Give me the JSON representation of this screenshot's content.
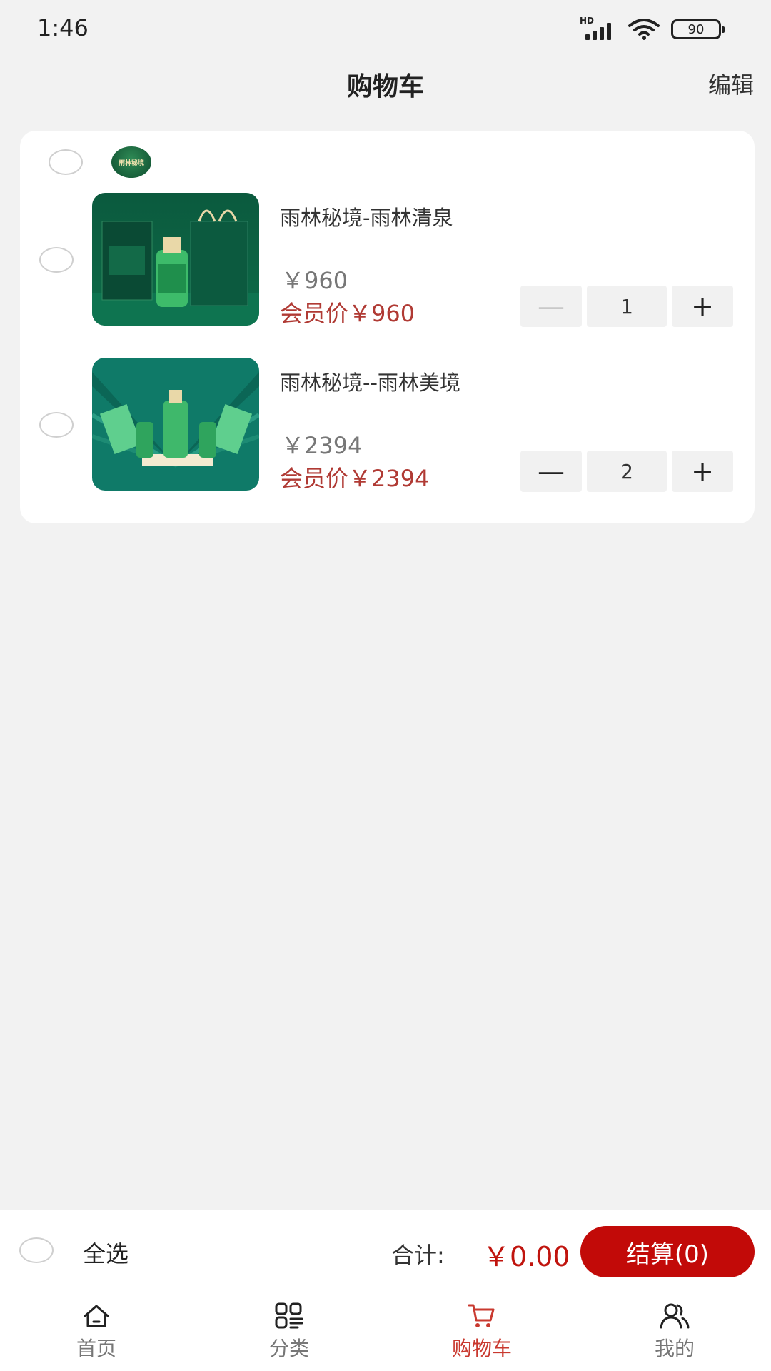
{
  "status_bar": {
    "time": "1:46",
    "network_label": "HD",
    "battery": "90"
  },
  "header": {
    "title": "购物车",
    "edit_label": "编辑"
  },
  "store": {
    "logo_text": "雨林秘境"
  },
  "items": [
    {
      "name": "雨林秘境-雨林清泉",
      "price": "￥960",
      "member_price": "会员价￥960",
      "quantity": "1",
      "minus_label": "—",
      "plus_label": "+",
      "minus_disabled": true
    },
    {
      "name": "雨林秘境--雨林美境",
      "price": "￥2394",
      "member_price": "会员价￥2394",
      "quantity": "2",
      "minus_label": "—",
      "plus_label": "+",
      "minus_disabled": false
    }
  ],
  "checkout": {
    "select_all_label": "全选",
    "total_label": "合计:",
    "total_value": "￥0.00",
    "button_label": "结算(0)"
  },
  "tabs": [
    {
      "label": "首页",
      "icon": "home-icon",
      "active": false
    },
    {
      "label": "分类",
      "icon": "category-icon",
      "active": false
    },
    {
      "label": "购物车",
      "icon": "cart-icon",
      "active": true
    },
    {
      "label": "我的",
      "icon": "user-icon",
      "active": false
    }
  ],
  "colors": {
    "accent_red": "#c20a08",
    "price_red": "#b03a34",
    "active_tab": "#c9392f",
    "background": "#f2f2f2"
  }
}
